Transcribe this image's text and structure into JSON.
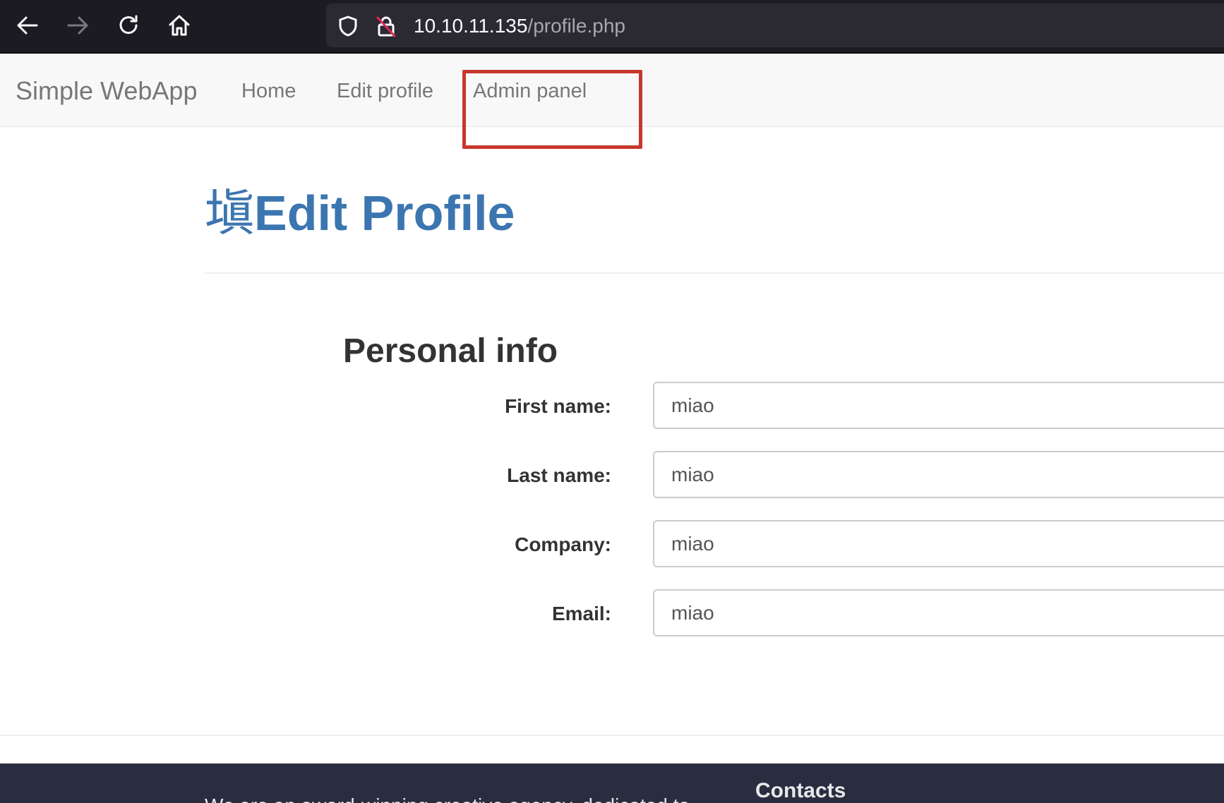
{
  "browser": {
    "url_host": "10.10.11.135",
    "url_path": "/profile.php",
    "icons": [
      "back-arrow-icon",
      "forward-arrow-icon",
      "reload-icon",
      "home-icon",
      "shield-icon",
      "insecure-lock-icon"
    ]
  },
  "navbar": {
    "brand": "Simple WebApp",
    "links": [
      {
        "label": "Home"
      },
      {
        "label": "Edit profile"
      },
      {
        "label": "Admin panel"
      }
    ],
    "highlight_color": "#c8372d"
  },
  "header": {
    "glyph": "塡",
    "title": "Edit Profile",
    "color": "#3c76b0"
  },
  "form": {
    "section_title": "Personal info",
    "fields": [
      {
        "label": "First name:",
        "value": "miao"
      },
      {
        "label": "Last name:",
        "value": "miao"
      },
      {
        "label": "Company:",
        "value": "miao"
      },
      {
        "label": "Email:",
        "value": "miao"
      }
    ]
  },
  "footer": {
    "text": "We are an award-winning creative agency, dedicated to",
    "contacts_heading": "Contacts"
  }
}
